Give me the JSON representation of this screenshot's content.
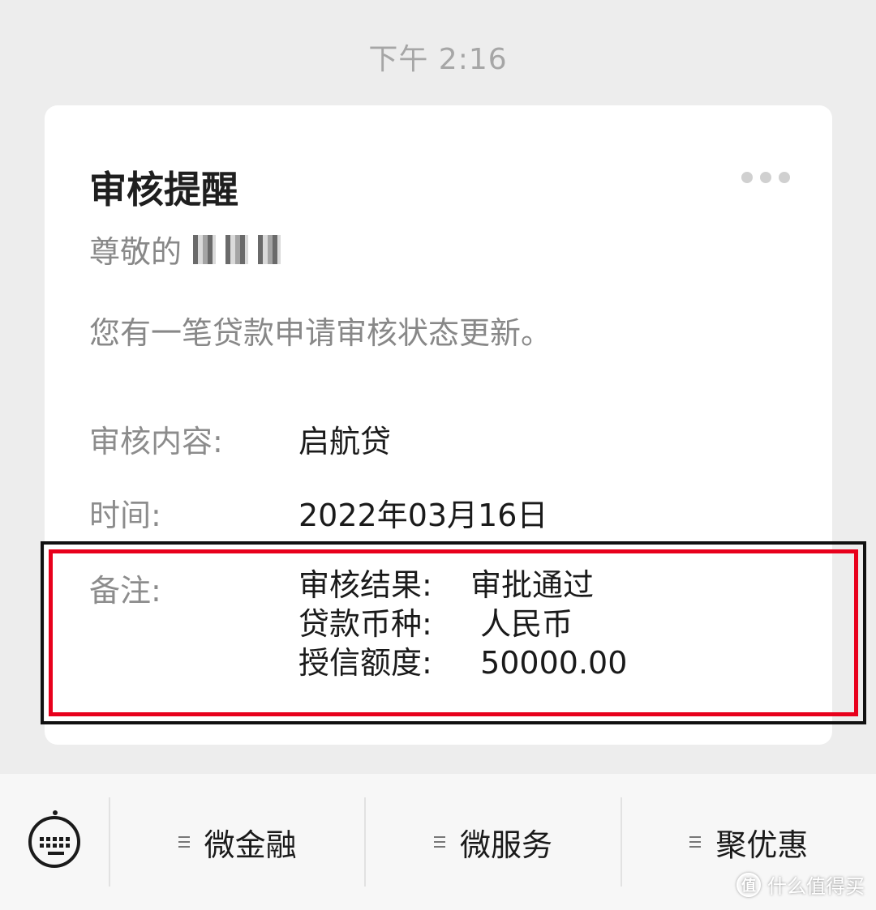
{
  "timestamp": "下午 2:16",
  "card": {
    "title": "审核提醒",
    "greeting_prefix": "尊敬的",
    "message": "您有一笔贷款申请审核状态更新。",
    "fields": {
      "content_label": "审核内容:",
      "content_value": "启航贷",
      "time_label": "时间:",
      "time_value": "2022年03月16日",
      "remark_label": "备注:"
    },
    "remark": [
      {
        "key": "审核结果:",
        "value": "审批通过"
      },
      {
        "key": "贷款币种:",
        "value": " 人民币"
      },
      {
        "key": "授信额度:",
        "value": " 50000.00"
      }
    ]
  },
  "colors": {
    "highlight": "#e8001c",
    "background": "#ededed"
  },
  "bottom_menu": {
    "keyboard_icon": "keyboard-icon",
    "items": [
      {
        "label": "微金融"
      },
      {
        "label": "微服务"
      },
      {
        "label": "聚优惠"
      }
    ]
  },
  "watermark": {
    "logo": "值",
    "text": "什么值得买"
  }
}
